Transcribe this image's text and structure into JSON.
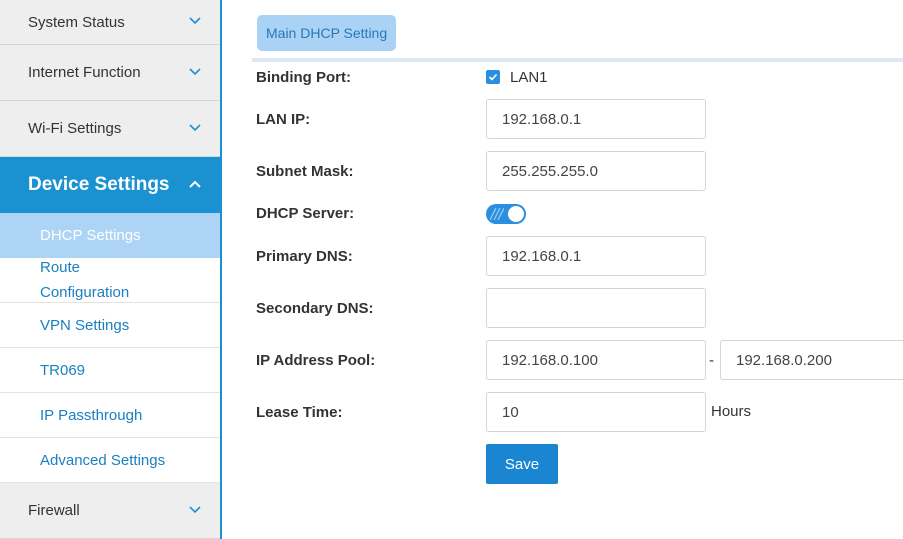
{
  "sidebar": {
    "items": [
      {
        "label": "System Status",
        "expanded": false
      },
      {
        "label": "Internet Function",
        "expanded": false
      },
      {
        "label": "Wi-Fi Settings",
        "expanded": false
      },
      {
        "label": "Device Settings",
        "expanded": true,
        "children": [
          {
            "label": "DHCP Settings",
            "selected": true
          },
          {
            "label": "Route Configuration"
          },
          {
            "label": "VPN Settings"
          },
          {
            "label": "TR069"
          },
          {
            "label": "IP Passthrough"
          },
          {
            "label": "Advanced Settings"
          }
        ]
      },
      {
        "label": "Firewall",
        "expanded": false
      }
    ]
  },
  "tabs": [
    {
      "label": "Main DHCP Setting",
      "active": true
    }
  ],
  "form": {
    "binding_port": {
      "label": "Binding Port:",
      "option": "LAN1",
      "checked": true
    },
    "lan_ip": {
      "label": "LAN IP:",
      "value": "192.168.0.1"
    },
    "subnet_mask": {
      "label": "Subnet Mask:",
      "value": "255.255.255.0"
    },
    "dhcp_server": {
      "label": "DHCP Server:",
      "enabled": true
    },
    "primary_dns": {
      "label": "Primary DNS:",
      "value": "192.168.0.1"
    },
    "secondary_dns": {
      "label": "Secondary DNS:",
      "value": ""
    },
    "ip_pool": {
      "label": "IP Address Pool:",
      "start": "192.168.0.100",
      "separator": "-",
      "end": "192.168.0.200"
    },
    "lease_time": {
      "label": "Lease Time:",
      "value": "10",
      "unit": "Hours"
    },
    "save_label": "Save"
  },
  "colors": {
    "accent": "#1a91d1",
    "selected_bg": "#add4f5",
    "tab_bg": "#a9d2f5",
    "link": "#1a7fc1",
    "toggle_on": "#2a8fe0"
  }
}
